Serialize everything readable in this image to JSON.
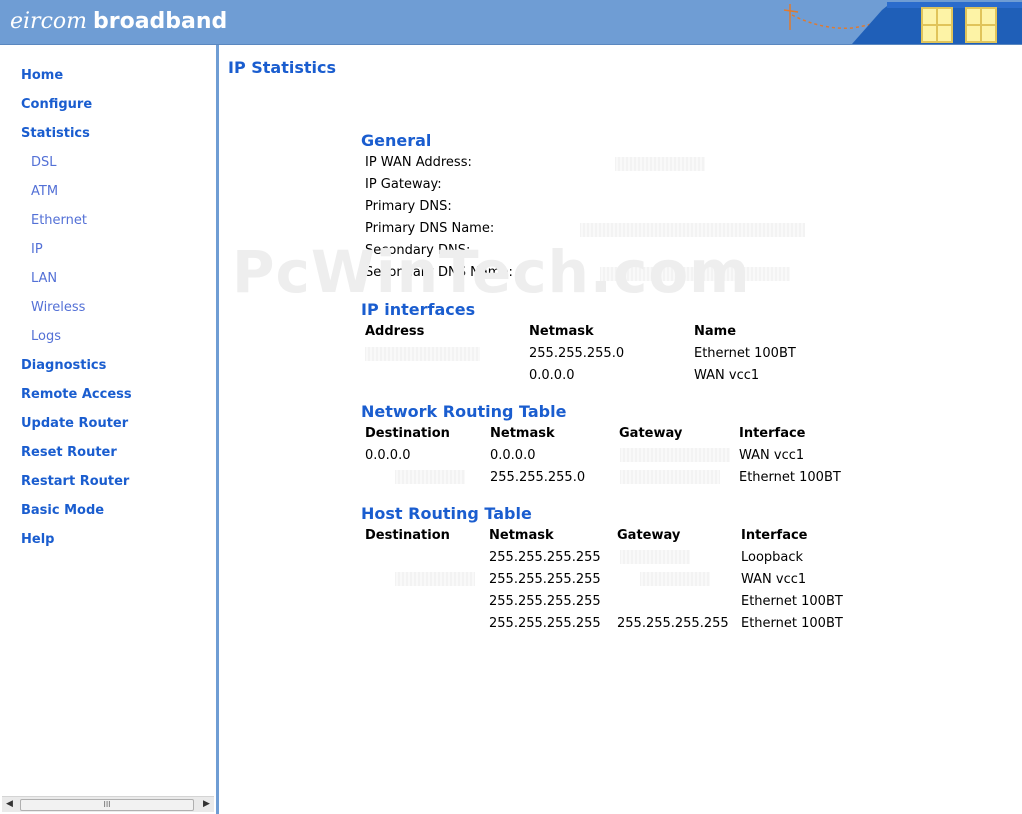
{
  "header": {
    "brand_light": "eircom",
    "brand_bold": "broadband"
  },
  "sidebar": {
    "items": [
      {
        "label": "Home",
        "level": "main"
      },
      {
        "label": "Configure",
        "level": "main"
      },
      {
        "label": "Statistics",
        "level": "main"
      },
      {
        "label": "DSL",
        "level": "sub"
      },
      {
        "label": "ATM",
        "level": "sub"
      },
      {
        "label": "Ethernet",
        "level": "sub"
      },
      {
        "label": "IP",
        "level": "sub"
      },
      {
        "label": "LAN",
        "level": "sub"
      },
      {
        "label": "Wireless",
        "level": "sub"
      },
      {
        "label": "Logs",
        "level": "sub"
      },
      {
        "label": "Diagnostics",
        "level": "main"
      },
      {
        "label": "Remote Access",
        "level": "main"
      },
      {
        "label": "Update Router",
        "level": "main"
      },
      {
        "label": "Reset Router",
        "level": "main"
      },
      {
        "label": "Restart Router",
        "level": "main"
      },
      {
        "label": "Basic Mode",
        "level": "main"
      },
      {
        "label": "Help",
        "level": "main"
      }
    ],
    "scroll_thumb": "III"
  },
  "page": {
    "title": "IP Statistics",
    "watermark": "PcWinTech.com"
  },
  "general": {
    "title": "General",
    "fields": [
      {
        "label": "IP WAN Address:"
      },
      {
        "label": "IP Gateway:"
      },
      {
        "label": "Primary DNS:"
      },
      {
        "label": "Primary DNS Name:"
      },
      {
        "label": "Secondary DNS:"
      },
      {
        "label": "Secondary DNS Name:"
      }
    ]
  },
  "ip_interfaces": {
    "title": "IP interfaces",
    "headers": [
      "Address",
      "Netmask",
      "Name"
    ],
    "rows": [
      [
        "",
        "255.255.255.0",
        "Ethernet 100BT"
      ],
      [
        "",
        "0.0.0.0",
        "WAN vcc1"
      ]
    ]
  },
  "network_routing": {
    "title": "Network Routing Table",
    "headers": [
      "Destination",
      "Netmask",
      "Gateway",
      "Interface"
    ],
    "rows": [
      [
        "0.0.0.0",
        "0.0.0.0",
        "",
        "WAN vcc1"
      ],
      [
        "",
        "255.255.255.0",
        "",
        "Ethernet 100BT"
      ]
    ]
  },
  "host_routing": {
    "title": "Host Routing Table",
    "headers": [
      "Destination",
      "Netmask",
      "Gateway",
      "Interface"
    ],
    "rows": [
      [
        "",
        "255.255.255.255",
        "",
        "Loopback"
      ],
      [
        "",
        "255.255.255.255",
        "",
        "WAN vcc1"
      ],
      [
        "",
        "255.255.255.255",
        "",
        "Ethernet 100BT"
      ],
      [
        "",
        "255.255.255.255",
        "255.255.255.255",
        "Ethernet 100BT"
      ]
    ]
  },
  "colors": {
    "header_blue": "#6f9dd4",
    "link_blue": "#1a5dcf",
    "sublink_blue": "#5370d6"
  }
}
